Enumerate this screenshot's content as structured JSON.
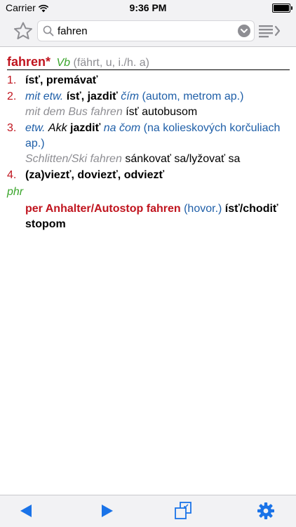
{
  "status_bar": {
    "carrier": "Carrier",
    "time": "9:36 PM"
  },
  "search": {
    "value": "fahren"
  },
  "icons": {
    "favorite": "star-icon",
    "search": "search-icon",
    "dropdown": "chevron-down-icon",
    "history": "list-arrow-icon",
    "back": "triangle-left-icon",
    "forward": "triangle-right-icon",
    "windows": "window-stack-icon",
    "settings": "gear-icon"
  },
  "colors": {
    "headword": "#c0141e",
    "pos": "#3aa52b",
    "translation_hint": "#1f5fa8",
    "example": "#8e8e93",
    "accent": "#1a73e8"
  },
  "entry": {
    "headword": "fahren*",
    "pos": "Vb",
    "grammar": "(fährt, u, i./h. a)",
    "senses": [
      {
        "number": "1.",
        "translation": "ísť, premávať"
      },
      {
        "number": "2.",
        "prefix": "mit etw.",
        "translation": "ísť, jazdiť",
        "object": "čím",
        "note": "(autom, metrom ap.)",
        "example_de": "mit dem Bus fahren",
        "example_sk": "ísť autobusom"
      },
      {
        "number": "3.",
        "prefix": "etw.",
        "case": "Akk",
        "translation": "jazdiť",
        "object": "na čom",
        "note_line1": "(na kolieskových korčuliach",
        "note_line2": "ap.)",
        "example_de": "Schlitten/Ski fahren",
        "example_sk": "sánkovať sa/lyžovať sa"
      },
      {
        "number": "4.",
        "translation": "(za)viezť, doviezť, odviezť"
      }
    ],
    "phrase_label": "phr",
    "phrase": {
      "de": "per Anhalter/Autostop fahren",
      "register": "(hovor.)",
      "sk_line1": "ísť/chodiť",
      "sk_line2": "stopom"
    }
  }
}
